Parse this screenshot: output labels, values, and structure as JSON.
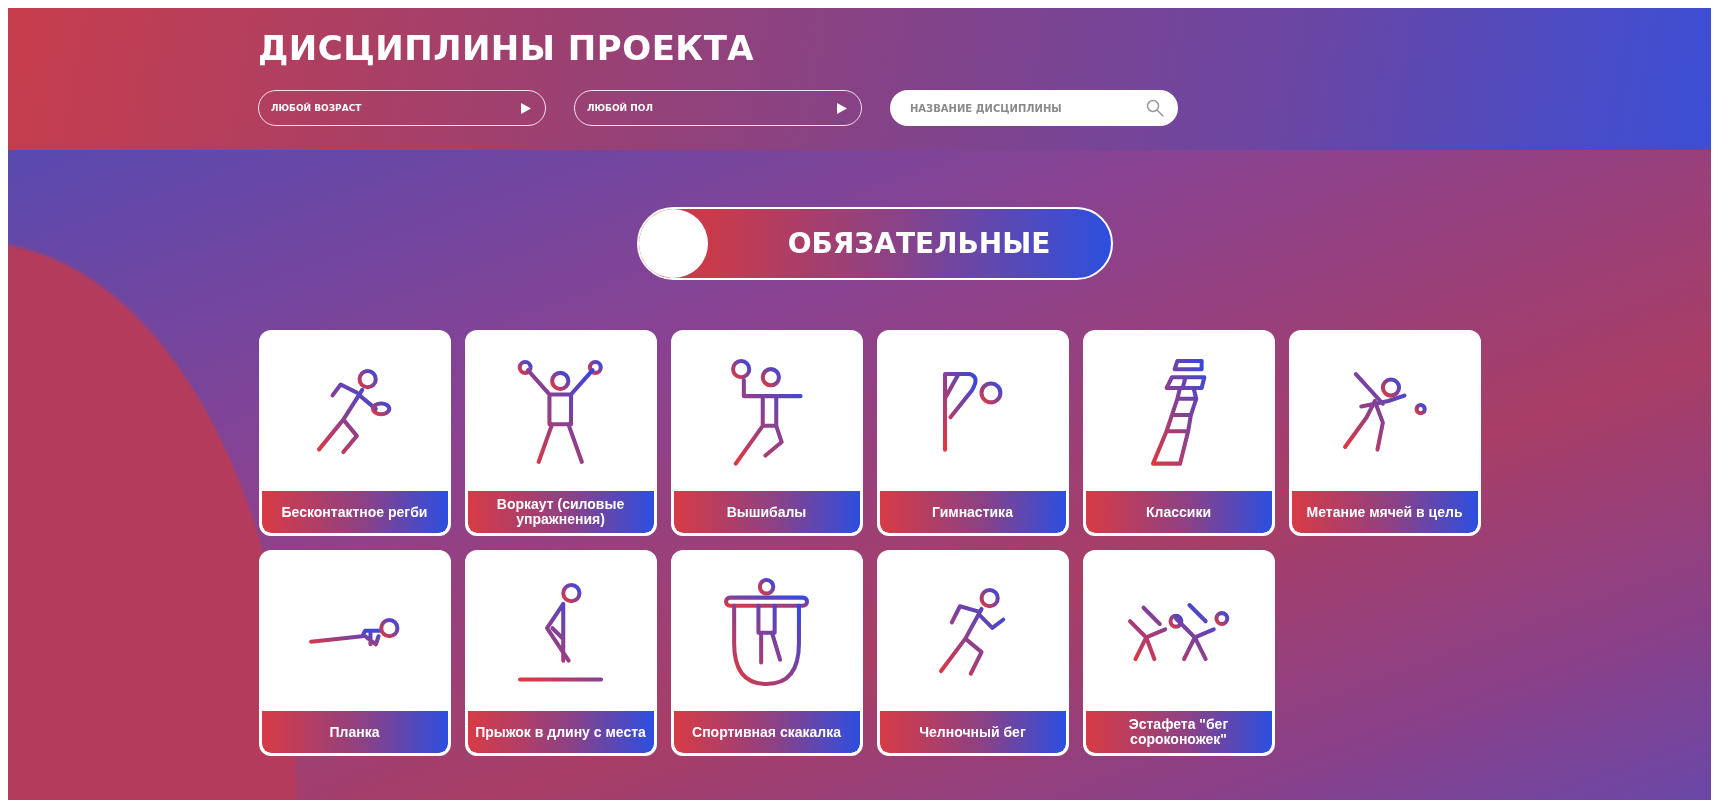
{
  "header": {
    "title": "ДИСЦИПЛИНЫ ПРОЕКТА",
    "filters": [
      {
        "kind": "dropdown",
        "value": "ЛЮБОЙ ВОЗРАСТ"
      },
      {
        "kind": "dropdown",
        "value": "ЛЮБОЙ ПОЛ"
      },
      {
        "kind": "search",
        "placeholder": "НАЗВАНИЕ ДИСЦИПЛИНЫ"
      }
    ]
  },
  "toggle": {
    "label": "ОБЯЗАТЕЛЬНЫЕ",
    "on": true
  },
  "disciplines": [
    {
      "label": "Бесконтактное регби"
    },
    {
      "label": "Воркаут (силовые упражнения)"
    },
    {
      "label": "Вышибалы"
    },
    {
      "label": "Гимнастика"
    },
    {
      "label": "Классики"
    },
    {
      "label": "Метание мячей в цель"
    },
    {
      "label": "Планка"
    },
    {
      "label": "Прыжок в длину с места"
    },
    {
      "label": "Спортивная скакалка"
    },
    {
      "label": "Челночный бег"
    },
    {
      "label": "Эстафета \"бег сороконожек\""
    }
  ]
}
